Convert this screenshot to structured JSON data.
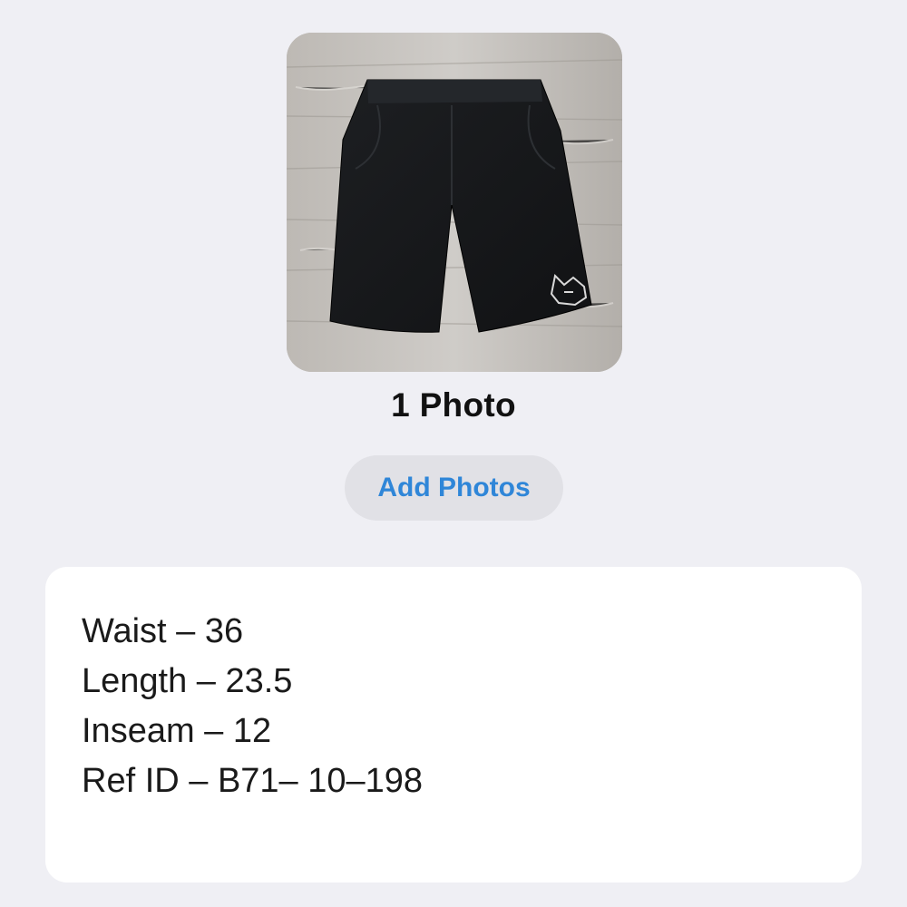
{
  "photos": {
    "count_label": "1 Photo",
    "add_button_label": "Add Photos",
    "thumbnail_logo_text": "FOX"
  },
  "notes": {
    "lines": [
      "Waist – 36",
      "Length – 23.5",
      "Inseam – 12",
      "Ref ID – B71– 10–198"
    ]
  },
  "colors": {
    "background": "#efeff4",
    "accent": "#2f86d8",
    "button_background": "#e1e1e6",
    "card_background": "#ffffff"
  }
}
